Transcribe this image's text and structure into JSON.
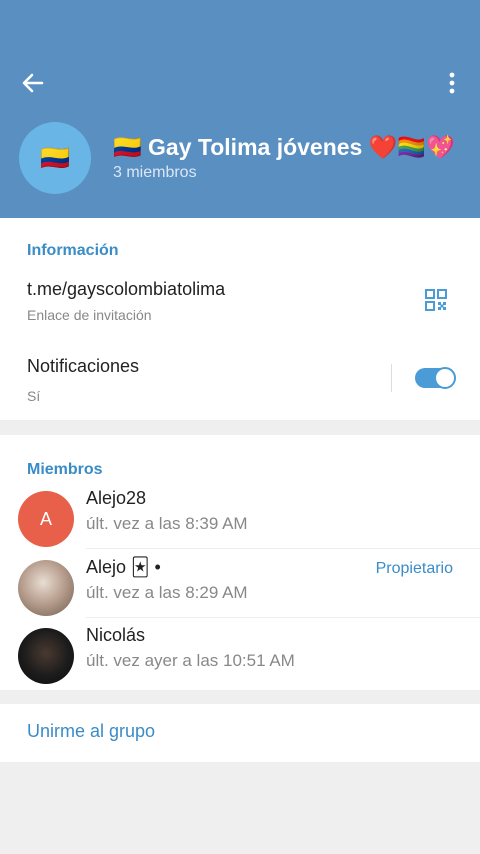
{
  "header": {
    "back_icon": "arrow-left-icon",
    "menu_icon": "more-vertical-icon",
    "title": "🇨🇴 Gay Tolima jóvenes ❤️🏳️‍🌈💖",
    "subtitle": "3 miembros",
    "avatar_emoji": "🇨🇴",
    "background_color": "#5a8fc2"
  },
  "info": {
    "section_title": "Información",
    "link": "t.me/gayscolombiatolima",
    "link_label": "Enlace de invitación",
    "qr_icon": "qr-code-icon",
    "notifications_label": "Notificaciones",
    "notifications_value": "Sí",
    "notifications_enabled": true
  },
  "members": {
    "section_title": "Miembros",
    "items": [
      {
        "name": "Alejo28",
        "status": "últ. vez a las 8:39 AM",
        "role": "",
        "avatar_letter": "A",
        "avatar_color": "#e8604a"
      },
      {
        "name": "Alejo 🃏 •",
        "status": "últ. vez a las 8:29 AM",
        "role": "Propietario",
        "avatar_letter": "",
        "avatar_color": "#b59b8a"
      },
      {
        "name": "Nicolás",
        "status": "últ. vez ayer a las 10:51 AM",
        "role": "",
        "avatar_letter": "",
        "avatar_color": "#1a1a1a"
      }
    ]
  },
  "join": {
    "label": "Unirme al grupo"
  },
  "colors": {
    "accent": "#3a8cc7",
    "toggle": "#4a9bd6"
  }
}
